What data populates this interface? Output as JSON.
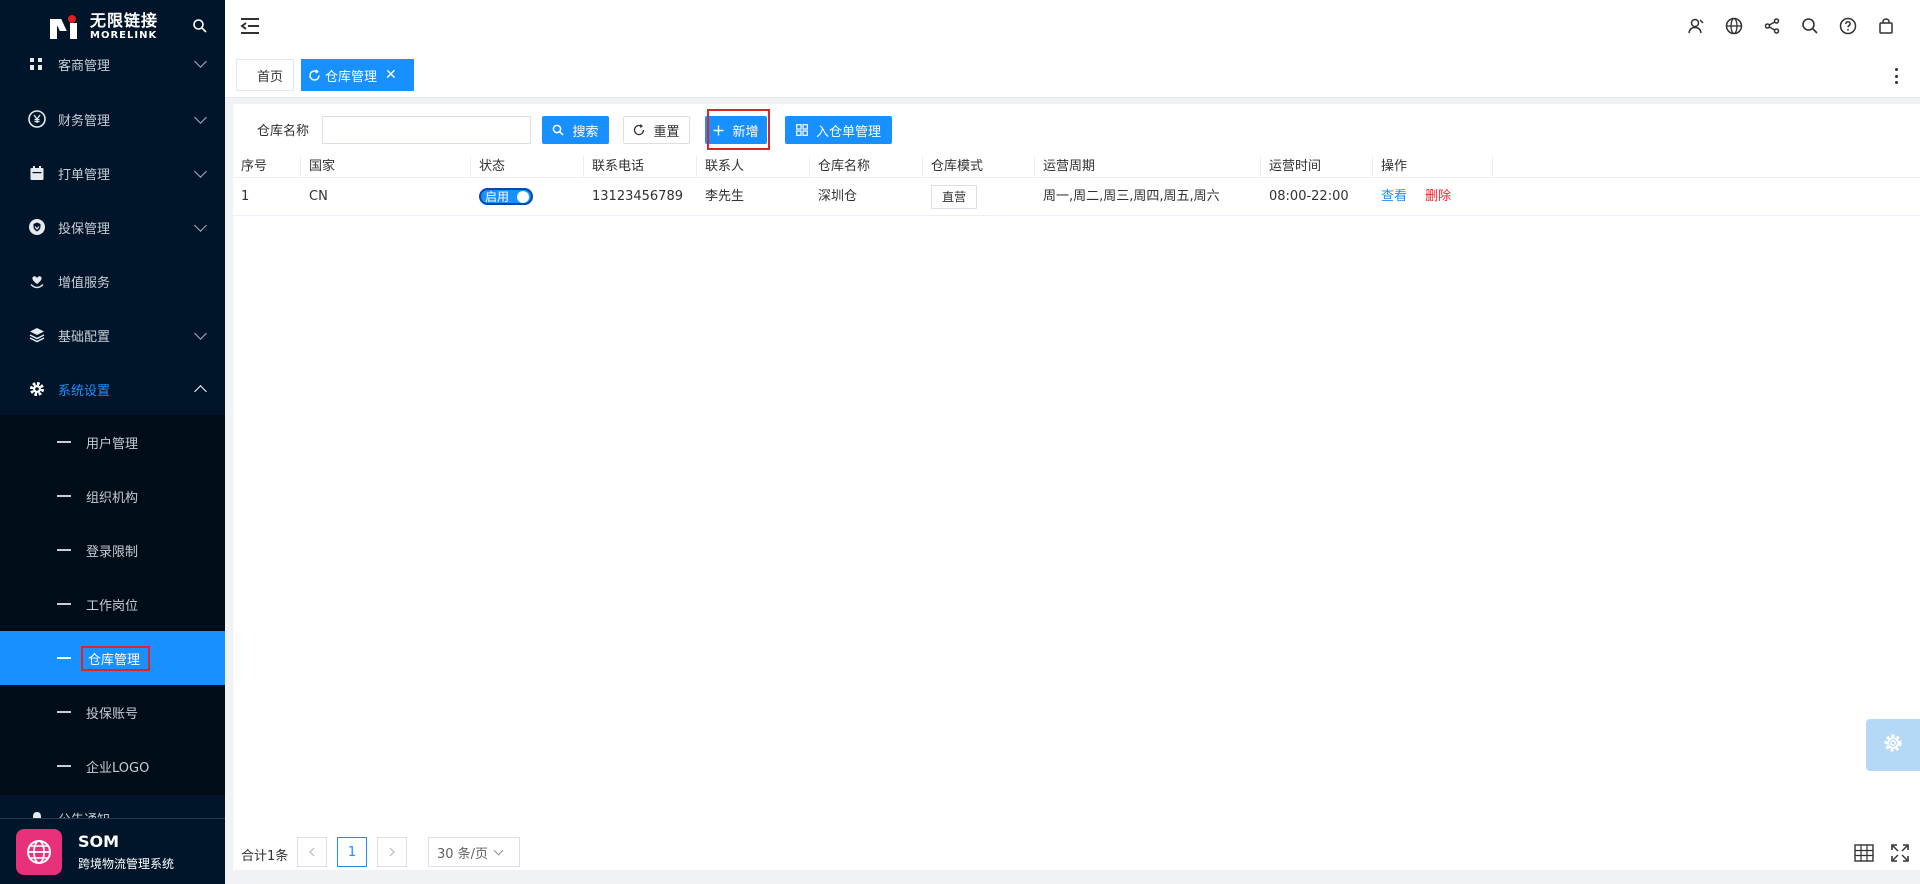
{
  "brand": {
    "name_cn": "无限链接",
    "name_en": "MORELINK"
  },
  "sidebar": {
    "menus": [
      {
        "label": "客商管理",
        "icon": "merchant-icon"
      },
      {
        "label": "财务管理",
        "icon": "yen-icon"
      },
      {
        "label": "打单管理",
        "icon": "calendar-icon"
      },
      {
        "label": "投保管理",
        "icon": "shield-icon"
      },
      {
        "label": "增值服务",
        "icon": "heart-hand-icon"
      },
      {
        "label": "基础配置",
        "icon": "layers-icon"
      },
      {
        "label": "系统设置",
        "icon": "gear-icon"
      }
    ],
    "submenus": [
      {
        "label": "用户管理"
      },
      {
        "label": "组织机构"
      },
      {
        "label": "登录限制"
      },
      {
        "label": "工作岗位"
      },
      {
        "label": "仓库管理"
      },
      {
        "label": "投保账号"
      },
      {
        "label": "企业LOGO"
      }
    ],
    "partial_item": "公告通知",
    "footer": {
      "title": "SOM",
      "subtitle": "跨境物流管理系统"
    }
  },
  "tabs": [
    {
      "label": "首页"
    },
    {
      "label": "仓库管理"
    }
  ],
  "filter": {
    "label": "仓库名称",
    "value": "",
    "search_label": "搜索",
    "reset_label": "重置",
    "add_label": "新增",
    "inbound_label": "入仓单管理"
  },
  "table": {
    "columns": [
      "序号",
      "国家",
      "状态",
      "联系电话",
      "联系人",
      "仓库名称",
      "仓库模式",
      "运营周期",
      "运营时间",
      "操作"
    ],
    "rows": [
      {
        "index": "1",
        "country": "CN",
        "status": "启用",
        "phone": "13123456789",
        "contact": "李先生",
        "warehouse": "深圳仓",
        "mode": "直营",
        "cycle": "周一,周二,周三,周四,周五,周六",
        "hours": "08:00-22:00",
        "view": "查看",
        "delete": "删除"
      }
    ]
  },
  "pagination": {
    "total": "合计1条",
    "current": "1",
    "page_size": "30 条/页"
  },
  "colors": {
    "sidebar_bg": "#001529",
    "accent": "#1890ff",
    "danger": "#f5222d",
    "highlight_box": "#e02424"
  }
}
